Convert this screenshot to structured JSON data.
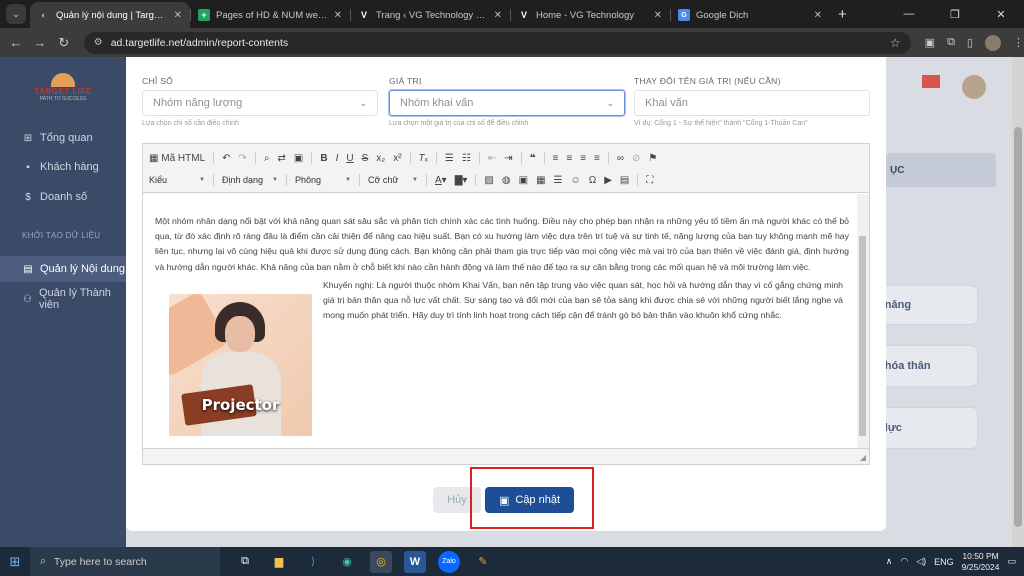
{
  "browser": {
    "tabs": [
      {
        "title": "Quản lý nội dung | Target Life",
        "icon": "target-life-favicon",
        "active": true
      },
      {
        "title": "Pages of HD & NUM web - Goo",
        "icon": "google-sheets-favicon"
      },
      {
        "title": "Trang ‹ VG Technology — Word",
        "icon": "vg-favicon"
      },
      {
        "title": "Home - VG Technology",
        "icon": "vg-favicon"
      },
      {
        "title": "Google Dịch",
        "icon": "google-translate-favicon"
      }
    ],
    "url": "ad.targetlife.net/admin/report-contents"
  },
  "sidebar": {
    "logo_name": "TARGET LIFE",
    "logo_tagline": "PATH TO SUCCESS",
    "items": [
      {
        "label": "Tổng quan",
        "icon": "dashboard-icon"
      },
      {
        "label": "Khách hàng",
        "icon": "user-icon"
      },
      {
        "label": "Doanh số",
        "icon": "dollar-icon"
      }
    ],
    "section": "KHỞI TẠO DỮ LIỆU",
    "items2": [
      {
        "label": "Quản lý Nội dung",
        "icon": "document-icon",
        "active": true
      },
      {
        "label": "Quản lý Thành viên",
        "icon": "users-icon"
      }
    ]
  },
  "background": {
    "tab_fragment": "ỤC",
    "cards": [
      "n năng",
      "o hóa thân",
      "g lực"
    ]
  },
  "modal": {
    "field1": {
      "label": "CHỈ SỐ",
      "value": "Nhóm năng lượng",
      "help": "Lựa chọn chỉ số cần điều chỉnh"
    },
    "field2": {
      "label": "GIÁ TRỊ",
      "value": "Nhóm khai vấn",
      "help": "Lựa chọn một giá trị của chỉ số để điều chỉnh"
    },
    "field3": {
      "label": "THAY ĐỔI TÊN GIÁ TRỊ (NẾU CẦN)",
      "value": "Khai vấn",
      "help": "Ví dụ: Cổng 1 - Sự thể hiện\" thành \"Cổng 1-Thuần Can\""
    },
    "toolbar": {
      "source_label": "Mã HTML",
      "styles": "Kiểu",
      "format": "Định dạng",
      "font": "Phông",
      "size": "Cỡ chữ"
    },
    "content": {
      "paragraph1": "Một nhóm nhân dạng nổi bật với khả năng quan sát sâu sắc và phân tích chính xác các tình huống. Điều này cho phép bạn nhận ra những yếu tố tiềm ẩn mà người khác có thể bỏ qua, từ đó xác định rõ ràng đâu là điểm cần cải thiện để nâng cao hiệu suất. Bạn có xu hướng làm việc dựa trên trí tuệ và sự tinh tế, năng lượng của bạn tuy không mạnh mẽ hay liên tục, nhưng lại vô cùng hiệu quả khi được sử dụng đúng cách. Bạn không cần phải tham gia trực tiếp vào mọi công việc mà vai trò của bạn thiên về việc đánh giá, định hướng và hướng dẫn người khác. Khả năng của bạn nằm ở chỗ biết khi nào cần hành động và làm thế nào để tạo ra sự cân bằng trong các mối quan hệ và môi trường làm việc.",
      "paragraph2": "Khuyến nghị: Là người thuộc nhóm Khai Vấn, bạn nên tập trung vào việc quan sát, học hỏi và hướng dẫn thay vì cố gắng chứng minh giá trị  bản thân qua nỗ lực vất chất. Sự sáng tạo và đổi mới của bạn sẽ tỏa sáng khi được chia sẻ với những người biết lắng nghe và mong muốn phát triển. Hãy duy trì tính linh hoạt trong cách tiếp cận để tránh gò bó bản thân vào khuôn khổ cứng nhắc.",
      "image_caption": "Projector"
    },
    "cancel_label": "Hủy",
    "save_label": "Cập nhật"
  },
  "taskbar": {
    "search_placeholder": "Type here to search",
    "lang": "ENG",
    "time": "10:50 PM",
    "date": "9/25/2024"
  },
  "colors": {
    "accent": "#1d4e96",
    "sidebar": "#3b4a66",
    "highlight": "#e02020"
  }
}
